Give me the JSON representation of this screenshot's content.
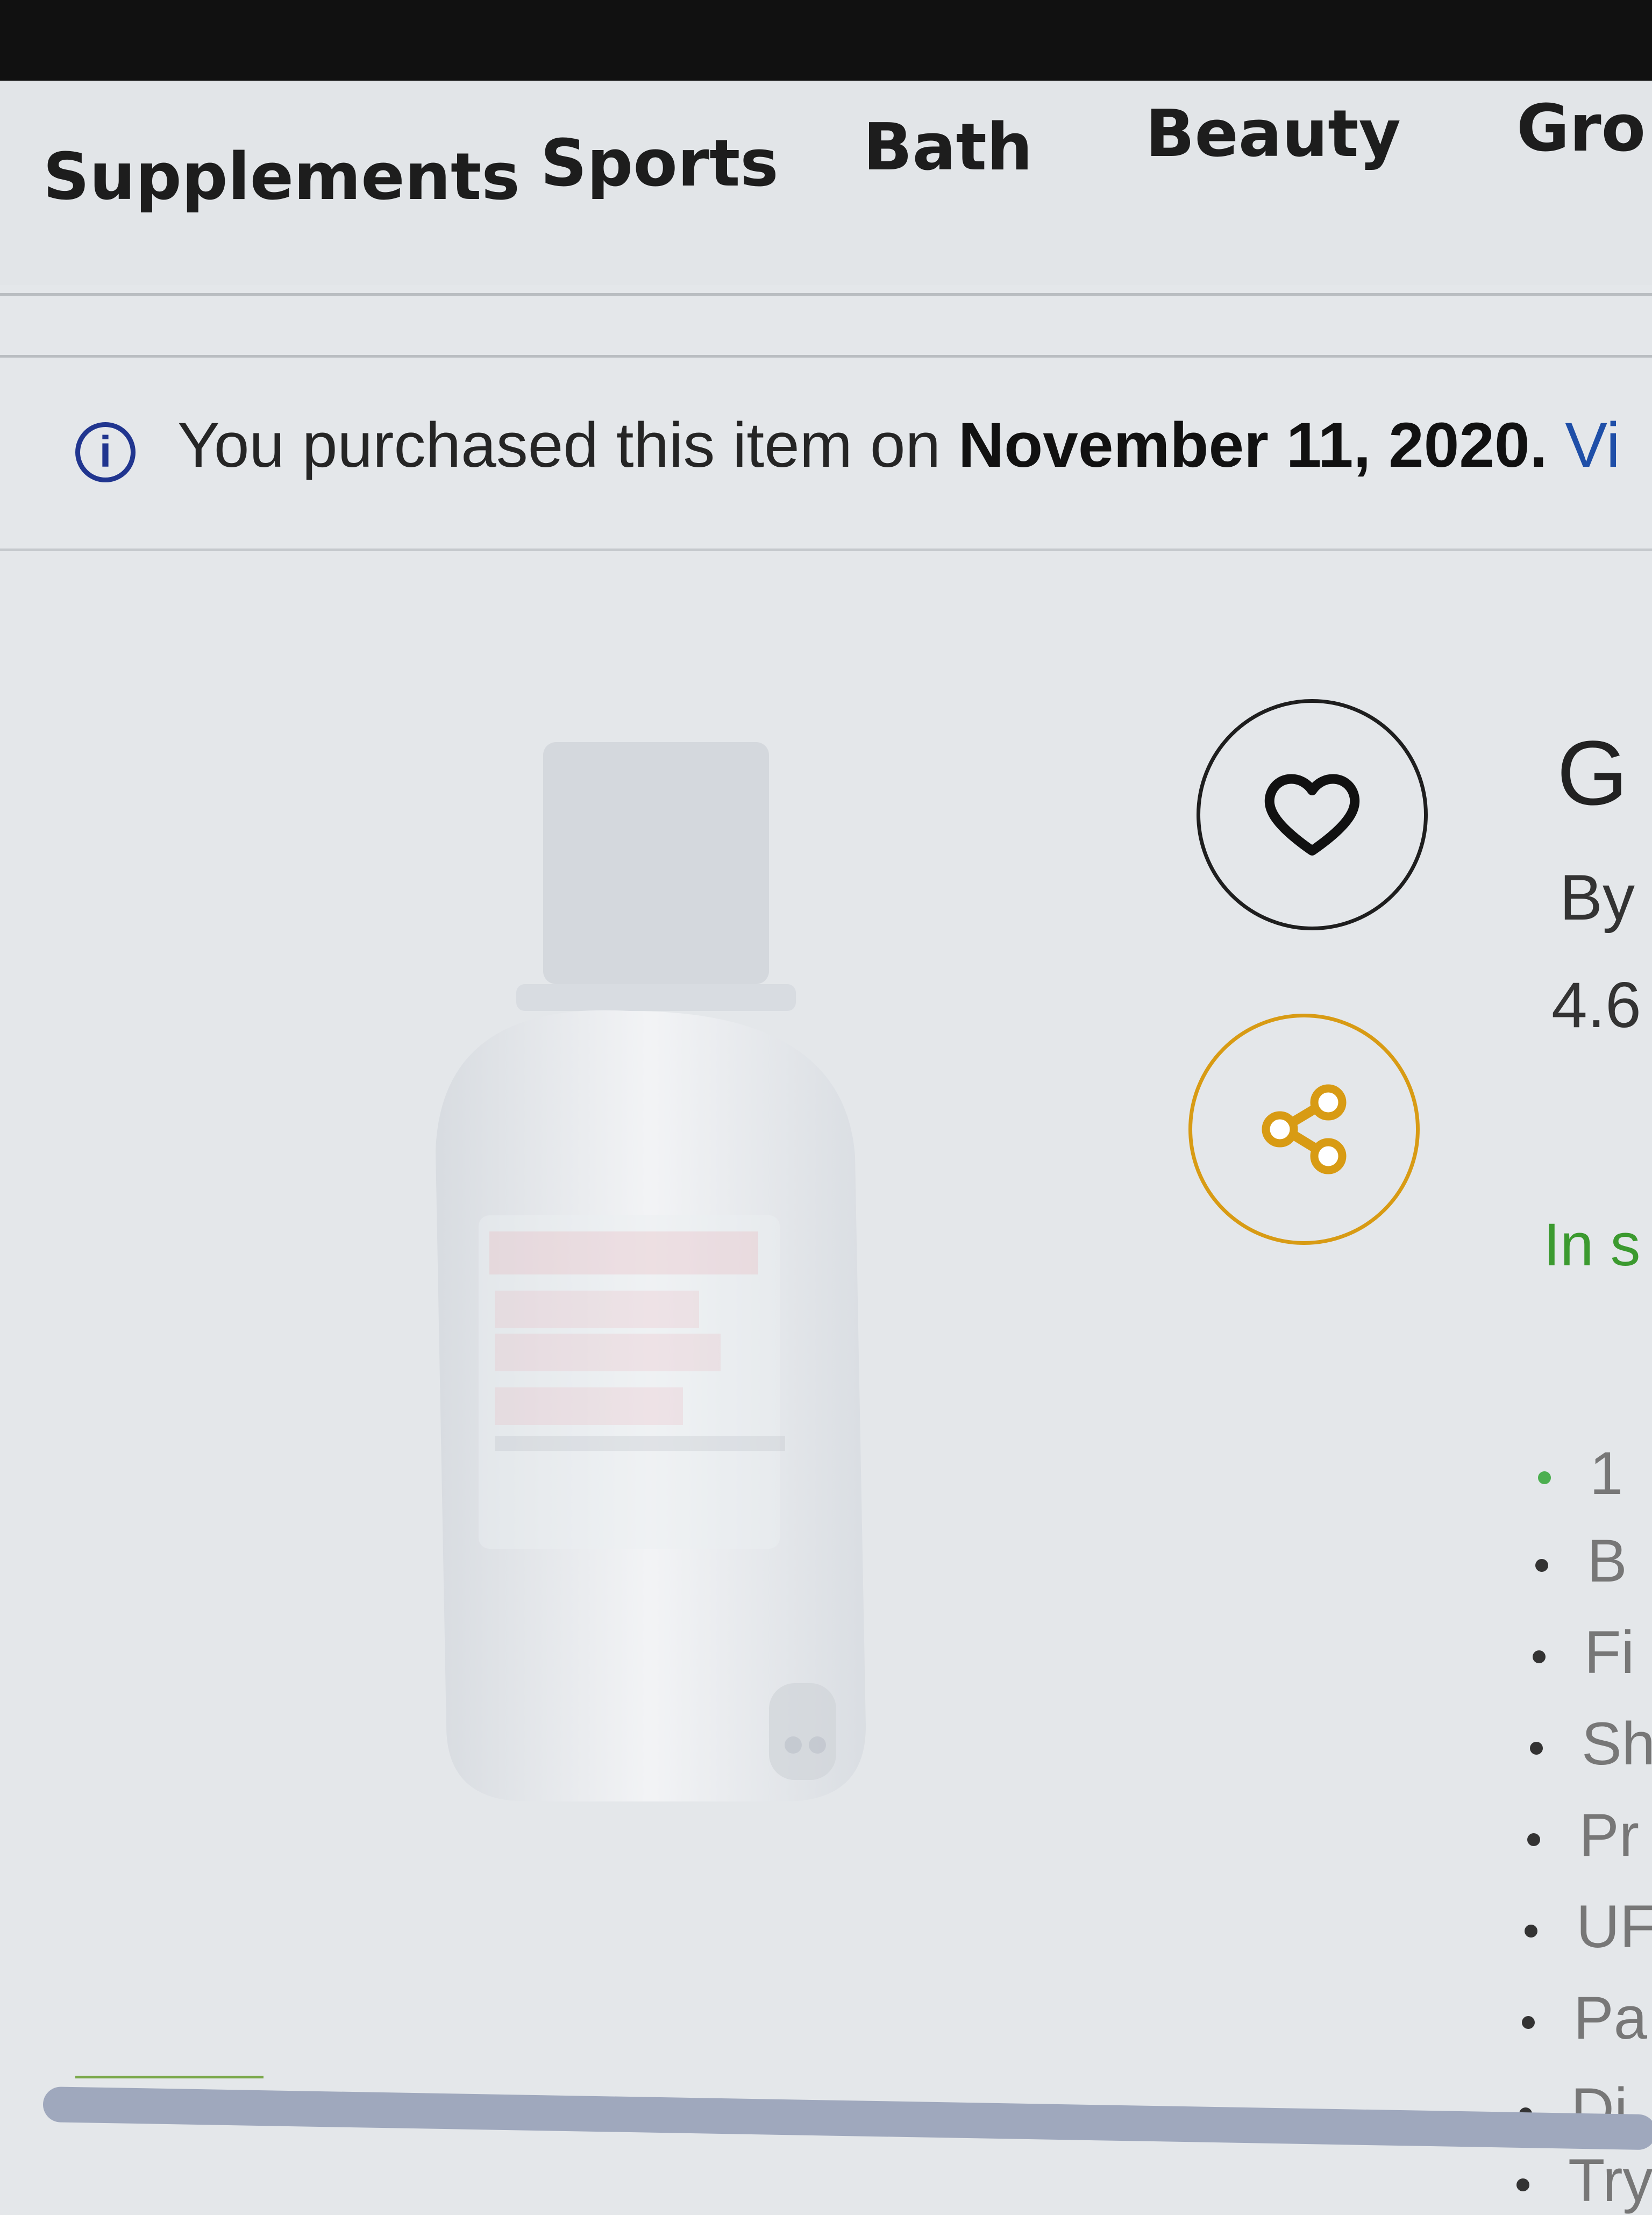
{
  "nav": {
    "categories": [
      "Supplements",
      "Sports",
      "Bath",
      "Beauty",
      "Gro"
    ]
  },
  "notice": {
    "prefix": "You purchased this item on ",
    "date": "November 11, 2020.",
    "link": " Vi"
  },
  "product": {
    "title_partial": "G",
    "by_partial": "By",
    "rating_partial": "4.6",
    "stock_partial": "In s",
    "features_partial": [
      "1",
      "B",
      "Fi",
      "Sh",
      "Pr",
      "UF",
      "Pa",
      "Di",
      "Try"
    ]
  },
  "icons": {
    "info": "info-icon",
    "favorite": "heart-icon",
    "share": "share-icon"
  },
  "colors": {
    "info_icon": "#20358f",
    "share_accent": "#d89b14",
    "in_stock": "#3b9a2f",
    "link": "#1f4fa8"
  }
}
